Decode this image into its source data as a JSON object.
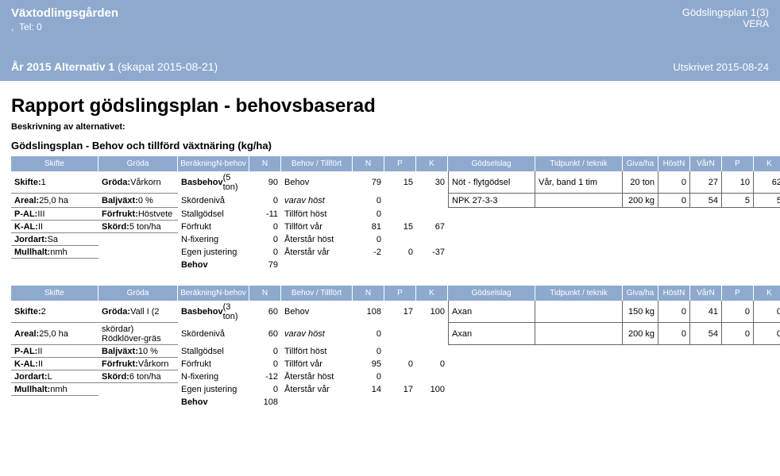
{
  "header": {
    "farm_name": "Växtodlingsgården",
    "tel_label": "Tel: 0",
    "plan_title": "Gödslingsplan 1(3)",
    "app_name": "VERA",
    "year_line_bold": "År 2015 Alternativ 1",
    "year_line_rest": " (skapat 2015-08-21)",
    "printed": "Utskrivet 2015-08-24"
  },
  "page": {
    "title": "Rapport gödslingsplan - behovsbaserad",
    "desc_label": "Beskrivning av alternativet:",
    "section_title": "Gödslingsplan - Behov och tillförd växtnäring (kg/ha)"
  },
  "columns": {
    "skifte": "Skifte",
    "groda": "Gröda",
    "berakning": "Beräkning N-behov",
    "n": "N",
    "behov_tillfort": "Behov / Tillfört",
    "n2": "N",
    "p": "P",
    "k": "K",
    "godselslag": "Gödselslag",
    "tidpunkt": "Tidpunkt / teknik",
    "giva": "Giva/ ha",
    "host_n": "Höst N",
    "var_n": "Vår N",
    "p2": "P",
    "k2": "K"
  },
  "blocks": [
    {
      "info": [
        {
          "lbl": "Skifte:",
          "val": " 1"
        },
        {
          "lbl": "Areal:",
          "val": " 25,0 ha"
        },
        {
          "lbl": "P-AL:",
          "val": " III"
        },
        {
          "lbl": "K-AL:",
          "val": " II"
        },
        {
          "lbl": "Jordart:",
          "val": " Sa"
        },
        {
          "lbl": "Mullhalt:",
          "val": " nmh"
        }
      ],
      "crop": [
        {
          "lbl": "Gröda:",
          "val": " Vårkorn"
        },
        {
          "lbl": "Baljväxt:",
          "val": " 0 %"
        },
        {
          "lbl": "Förfrukt:",
          "val": " Höstvete"
        },
        {
          "lbl": "Skörd:",
          "val": " 5 ton/ha"
        }
      ],
      "calc": [
        {
          "name": "Basbehov (5 ton)",
          "n": "90",
          "bold": true
        },
        {
          "name": "Skördenivå",
          "n": "0"
        },
        {
          "name": "Stallgödsel",
          "n": "-11"
        },
        {
          "name": "Förfrukt",
          "n": "0"
        },
        {
          "name": "N-fixering",
          "n": "0"
        },
        {
          "name": "Egen justering",
          "n": "0"
        },
        {
          "name": "Behov",
          "n": "79",
          "bold": true
        }
      ],
      "need": [
        {
          "name": "Behov",
          "n": "79",
          "p": "15",
          "k": "30"
        },
        {
          "name": "varav höst",
          "n": "0",
          "p": "",
          "k": "",
          "it": true
        },
        {
          "name": "Tillfört höst",
          "n": "0",
          "p": "",
          "k": ""
        },
        {
          "name": "Tillfört vår",
          "n": "81",
          "p": "15",
          "k": "67"
        },
        {
          "name": "Återstår höst",
          "n": "0",
          "p": "",
          "k": ""
        },
        {
          "name": "Återstår vår",
          "n": "-2",
          "p": "0",
          "k": "-37"
        }
      ],
      "fert": [
        {
          "name": "Nöt - flytgödsel",
          "time": "Vår, band 1 tim",
          "giva": "20 ton",
          "host": "0",
          "var": "27",
          "p": "10",
          "k": "62"
        },
        {
          "name": "NPK 27-3-3",
          "time": "",
          "giva": "200 kg",
          "host": "0",
          "var": "54",
          "p": "5",
          "k": "5"
        }
      ]
    },
    {
      "info": [
        {
          "lbl": "Skifte:",
          "val": " 2"
        },
        {
          "lbl": "Areal:",
          "val": " 25,0 ha"
        },
        {
          "lbl": "P-AL:",
          "val": " II"
        },
        {
          "lbl": "K-AL:",
          "val": " II"
        },
        {
          "lbl": "Jordart:",
          "val": " L"
        },
        {
          "lbl": "Mullhalt:",
          "val": " nmh"
        }
      ],
      "crop": [
        {
          "lbl": "Gröda:",
          "val": " Vall I (2 skördar) Rödklöver-gräs"
        },
        {
          "lbl": "Baljväxt:",
          "val": " 10 %"
        },
        {
          "lbl": "Förfrukt:",
          "val": " Vårkorn"
        },
        {
          "lbl": "Skörd:",
          "val": " 6 ton/ha"
        }
      ],
      "calc": [
        {
          "name": "Basbehov (3 ton)",
          "n": "60",
          "bold": true
        },
        {
          "name": "Skördenivå",
          "n": "60"
        },
        {
          "name": "Stallgödsel",
          "n": "0"
        },
        {
          "name": "Förfrukt",
          "n": "0"
        },
        {
          "name": "N-fixering",
          "n": "-12"
        },
        {
          "name": "Egen justering",
          "n": "0"
        },
        {
          "name": "Behov",
          "n": "108",
          "bold": true
        }
      ],
      "need": [
        {
          "name": "Behov",
          "n": "108",
          "p": "17",
          "k": "100"
        },
        {
          "name": "varav höst",
          "n": "0",
          "p": "",
          "k": "",
          "it": true
        },
        {
          "name": "Tillfört höst",
          "n": "0",
          "p": "",
          "k": ""
        },
        {
          "name": "Tillfört vår",
          "n": "95",
          "p": "0",
          "k": "0"
        },
        {
          "name": "Återstår höst",
          "n": "0",
          "p": "",
          "k": ""
        },
        {
          "name": "Återstår vår",
          "n": "14",
          "p": "17",
          "k": "100"
        }
      ],
      "fert": [
        {
          "name": "Axan",
          "time": "",
          "giva": "150 kg",
          "host": "0",
          "var": "41",
          "p": "0",
          "k": "0"
        },
        {
          "name": "Axan",
          "time": "",
          "giva": "200 kg",
          "host": "0",
          "var": "54",
          "p": "0",
          "k": "0"
        }
      ]
    }
  ]
}
